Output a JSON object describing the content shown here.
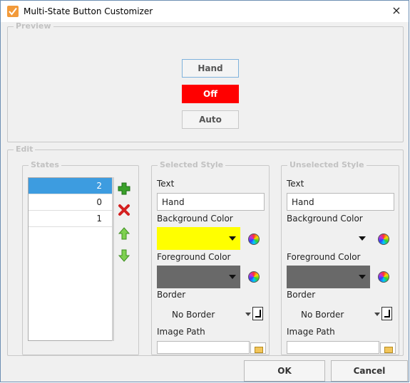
{
  "window": {
    "title": "Multi-State Button Customizer",
    "close_glyph": "×"
  },
  "preview": {
    "legend": "Preview",
    "buttons": [
      {
        "label": "Hand"
      },
      {
        "label": "Off",
        "background": "#ff0000",
        "foreground": "#ffffff"
      },
      {
        "label": "Auto"
      }
    ]
  },
  "edit": {
    "legend": "Edit",
    "states": {
      "legend": "States",
      "items": [
        "2",
        "0",
        "1"
      ],
      "selected_index": 0,
      "tools": [
        "add-icon",
        "remove-icon",
        "move-up-icon",
        "move-down-icon"
      ]
    },
    "selected_style": {
      "legend": "Selected Style",
      "text_label": "Text",
      "text_value": "Hand",
      "background_label": "Background Color",
      "background_color": "#ffff00",
      "foreground_label": "Foreground Color",
      "foreground_color": "#696969",
      "border_label": "Border",
      "border_value": "No Border",
      "image_label": "Image Path",
      "image_value": ""
    },
    "unselected_style": {
      "legend": "Unselected Style",
      "text_label": "Text",
      "text_value": "Hand",
      "background_label": "Background Color",
      "background_color": "#f0f0f0",
      "foreground_label": "Foreground Color",
      "foreground_color": "#696969",
      "border_label": "Border",
      "border_value": "No Border",
      "image_label": "Image Path",
      "image_value": ""
    }
  },
  "footer": {
    "ok_label": "OK",
    "cancel_label": "Cancel"
  }
}
